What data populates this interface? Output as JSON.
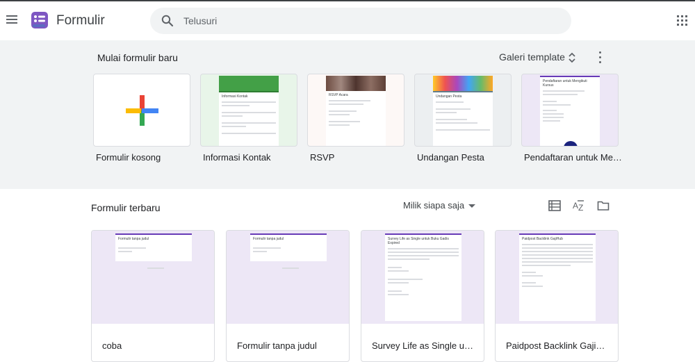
{
  "header": {
    "app_title": "Formulir",
    "search_placeholder": "Telusuri",
    "icons": [
      "hamburger-menu-icon",
      "forms-logo-icon",
      "search-icon",
      "apps-grid-icon"
    ]
  },
  "new_forms": {
    "title": "Mulai formulir baru",
    "gallery_label": "Galeri template",
    "templates": [
      {
        "label": "Formulir kosong",
        "thumb_title": ""
      },
      {
        "label": "Informasi Kontak",
        "thumb_title": "Informasi Kontak"
      },
      {
        "label": "RSVP",
        "thumb_title": "RSVP Acara"
      },
      {
        "label": "Undangan Pesta",
        "thumb_title": "Undangan Pesta"
      },
      {
        "label": "Pendaftaran untuk Me…",
        "thumb_title": "Pendaftaran untuk Mengikuti Kursus"
      }
    ]
  },
  "recent": {
    "title": "Formulir terbaru",
    "owner_filter": "Milik siapa saja",
    "docs": [
      {
        "title": "coba",
        "preview_title": "Formulir tanpa judul"
      },
      {
        "title": "Formulir tanpa judul",
        "preview_title": "Formulir tanpa judul"
      },
      {
        "title": "Survey Life as Single untu…",
        "preview_title": "Survey Life as Single untuk Buku Gadis Expired"
      },
      {
        "title": "Paidpost Backlink GajiHub",
        "preview_title": "Paidpost Backlink GajiHub"
      }
    ]
  },
  "colors": {
    "accent": "#673ab7",
    "background_band": "#f1f3f4",
    "preview_bg": "#ede7f6"
  }
}
